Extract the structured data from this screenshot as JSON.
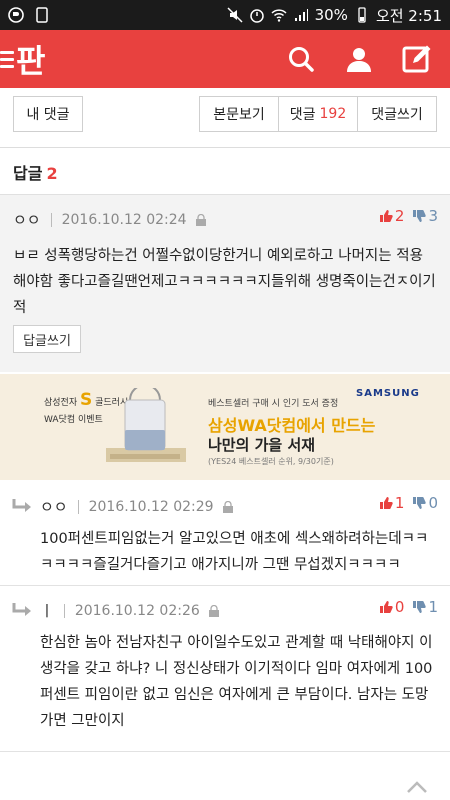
{
  "status_bar": {
    "battery": "30%",
    "time": "오전 2:51"
  },
  "header": {
    "logo": "판",
    "icons": [
      "menu-icon",
      "search-icon",
      "profile-icon",
      "write-icon"
    ]
  },
  "tabs": {
    "my_comments": "내 댓글",
    "view_post": "본문보기",
    "comments_label": "댓글",
    "comments_count": "192",
    "write_comment": "댓글쓰기"
  },
  "replies_section": {
    "label": "답글",
    "count": "2"
  },
  "main_comment": {
    "author": "ㅇㅇ",
    "date": "2016.10.12 02:24",
    "up": "2",
    "down": "3",
    "text": "ㅂㄹ 성폭행당하는건 어쩔수없이당한거니 예외로하고 나머지는 적용해야함 좋다고즐길땐언제고ㅋㅋㅋㅋㅋㅋ지들위해 생명죽이는건ㅈ이기적",
    "reply_button": "답글쓰기"
  },
  "ad": {
    "brand_small": "삼성전자",
    "brand_name": "골드러시",
    "brand_sub": "WA닷컴 이벤트",
    "samsung": "SAMSUNG",
    "line1": "베스트셀러 구매 시 인기 도서 증정",
    "line2": "삼성WA닷컴에서 만드는",
    "line3": "나만의 가을 서재",
    "line4": "(YES24 베스트셀러 순위, 9/30기준)"
  },
  "replies": [
    {
      "author": "ㅇㅇ",
      "date": "2016.10.12 02:29",
      "up": "1",
      "down": "0",
      "text": "100퍼센트피임없는거 알고있으면 애초에 섹스왜하려하는데ㅋㅋㅋㅋㅋㅋ즐길거다즐기고 애가지니까 그땐 무섭겠지ㅋㅋㅋㅋ"
    },
    {
      "author": "ㅣ",
      "date": "2016.10.12 02:26",
      "up": "0",
      "down": "1",
      "text": "한심한 놈아 전남자친구 아이일수도있고 관계할 때 낙태해야지 이생각을 갖고 하냐? 니 정신상태가 이기적이다 임마 여자에게 100퍼센트 피임이란 없고 임신은 여자에게 큰 부담이다. 남자는 도망가면 그만이지"
    }
  ],
  "colors": {
    "brand_red": "#e8413f",
    "down_blue": "#6f8fb0"
  }
}
